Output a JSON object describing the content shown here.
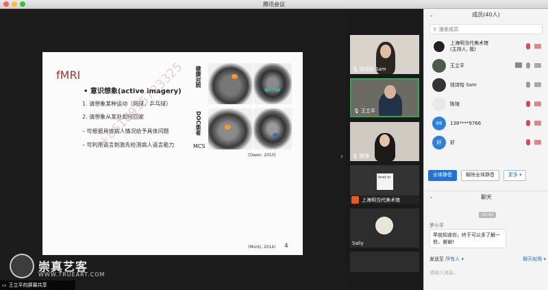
{
  "window": {
    "title": "腾讯会议"
  },
  "slide": {
    "title": "fMRI",
    "heading": "• 意识想象(active imagery)",
    "lines": [
      "1. 请想象某种运动（网球，乒乓球）",
      "2. 请想象从某处如何回家",
      "– 可根据具体病人情况给予具体问题",
      "– 可利用语言刺激先检测病人语言能力"
    ],
    "label_top": "健康对照",
    "label_bottom": "DOC患者",
    "mcs": "MCS",
    "citation1": "(Owen, 2010)",
    "citation2": "(Monti, 2014)",
    "page": "4",
    "watermark": "+8618915723325"
  },
  "branding": {
    "name": "崇真艺客",
    "sub": "WWW.TRUEART.COM"
  },
  "share_label": "王立平的屏幕共享",
  "video_tiles": [
    {
      "name": "钱诗怡 Sam",
      "active": false
    },
    {
      "name": "王立平",
      "active": true
    },
    {
      "name": "陈琦",
      "active": false
    },
    {
      "name": "上海明当代美术馆",
      "active": false,
      "thumb_text": "lerat or"
    },
    {
      "name": "Sally",
      "active": false
    }
  ],
  "members_panel": {
    "title": "成员(40人)",
    "search_placeholder": "搜索成员",
    "members": [
      {
        "name": "上海明当代美术馆",
        "sub": "(主持人, 我)",
        "color": "#222222"
      },
      {
        "name": "王立平",
        "sub": "",
        "color": "#4b5a4a"
      },
      {
        "name": "钱诗怡 Sam",
        "sub": "",
        "color": "#333333"
      },
      {
        "name": "陈琦",
        "sub": "",
        "color": "#e9e9e9"
      },
      {
        "name": "138****9766",
        "sub": "",
        "color": "#2f7fe0",
        "initial": "66"
      },
      {
        "name": "好",
        "sub": "",
        "color": "#2f7fe0",
        "initial": "好"
      }
    ],
    "buttons": {
      "mute_all": "全体静音",
      "unmute_all": "解除全体静音",
      "more": "更多"
    }
  },
  "chat": {
    "title": "聊天",
    "timestamp": "15:42",
    "sender": "罗小平",
    "message": "早就知道你，终于可以多了解一些，谢谢!",
    "send_to_label": "发送至",
    "send_to_value": "所有人",
    "permission": "聊天权限",
    "input_placeholder": "请输入消息..."
  }
}
